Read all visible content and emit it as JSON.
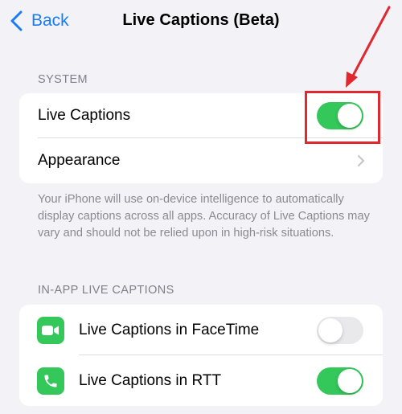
{
  "nav": {
    "back_label": "Back",
    "title": "Live Captions (Beta)"
  },
  "system": {
    "header": "SYSTEM",
    "live_captions": {
      "label": "Live Captions",
      "state": "on"
    },
    "appearance": {
      "label": "Appearance"
    },
    "footer": "Your iPhone will use on-device intelligence to automatically display captions across all apps. Accuracy of Live Captions may vary and should not be relied upon in high-risk situations."
  },
  "in_app": {
    "header": "IN-APP LIVE CAPTIONS",
    "facetime": {
      "label": "Live Captions in FaceTime",
      "state": "off",
      "icon": "facetime-icon"
    },
    "rtt": {
      "label": "Live Captions in RTT",
      "state": "on",
      "icon": "phone-icon"
    }
  },
  "colors": {
    "accent": "#1a7cf5",
    "toggle_on": "#34c759",
    "toggle_off": "#e9e9eb",
    "annotation": "#e0282e"
  }
}
